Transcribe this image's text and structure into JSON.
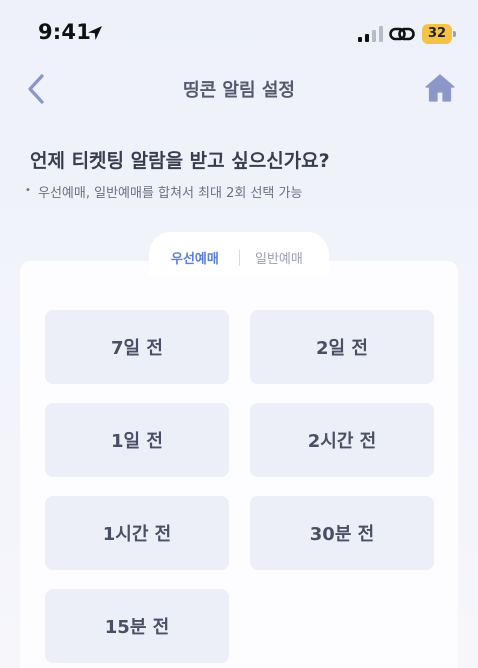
{
  "status_bar": {
    "time": "9:41",
    "battery_level": "32",
    "battery_color": "#f4c244"
  },
  "header": {
    "title": "띵콘 알림 설정",
    "back_icon": "chevron-left-icon",
    "home_icon": "home-icon"
  },
  "question": {
    "title": "언제 티켓팅 알람을 받고 싶으신가요?",
    "note": "우선예매, 일반예매를 합쳐서 최대 2회 선택 가능"
  },
  "tabs": [
    {
      "label": "우선예매",
      "active": true
    },
    {
      "label": "일반예매",
      "active": false
    }
  ],
  "options": [
    {
      "label": "7일 전"
    },
    {
      "label": "2일 전"
    },
    {
      "label": "1일 전"
    },
    {
      "label": "2시간 전"
    },
    {
      "label": "1시간 전"
    },
    {
      "label": "30분 전"
    },
    {
      "label": "15분 전"
    }
  ],
  "colors": {
    "accent": "#5b7fd6",
    "icon": "#8a97c8",
    "option_bg": "#eceff8"
  }
}
